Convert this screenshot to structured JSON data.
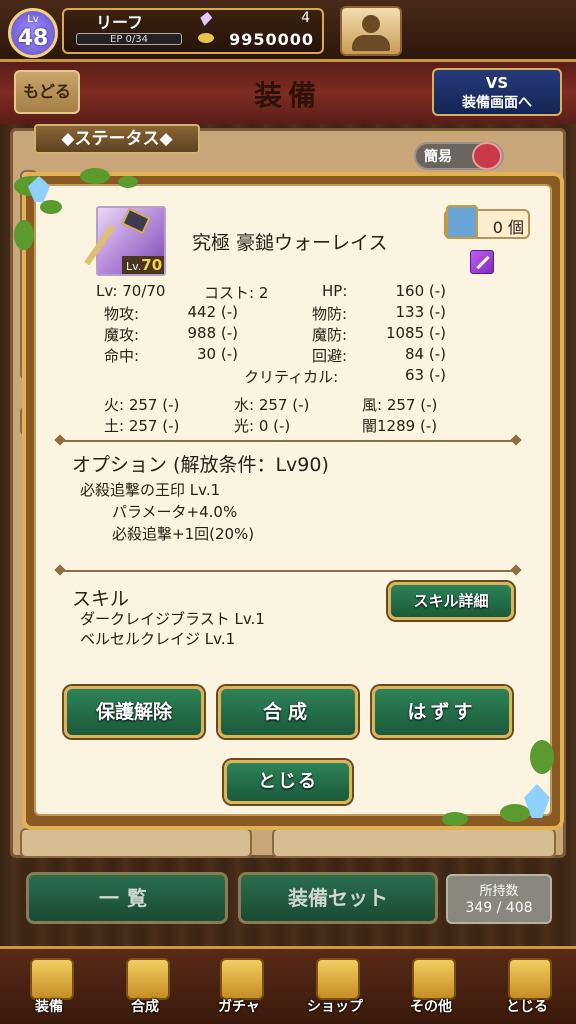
{
  "player": {
    "level_prefix": "Lv",
    "level": "48",
    "name": "リーフ",
    "ep_label": "EP 0/34",
    "crystals": "4",
    "gold": "9950000"
  },
  "header": {
    "back_label": "もどる",
    "title": "装備",
    "vs_line1": "VS",
    "vs_line2": "装備画面へ"
  },
  "status_tab_label": "◆ステータス◆",
  "simple_toggle_label": "簡易",
  "item": {
    "name": "究極 豪鎚ウォーレイス",
    "lv_prefix": "Lv.",
    "lv": "70",
    "owned": "0 個",
    "icons": {
      "weapon_type": "purple-staff-icon",
      "owned": "character-frame-icon"
    }
  },
  "stats": {
    "lv": "Lv:  70/70",
    "cost": "コスト: 2",
    "hp_label": "HP:",
    "hp_value": "160 (-)",
    "patk_label": "物攻:",
    "patk_value": "442 (-)",
    "pdef_label": "物防:",
    "pdef_value": "133 (-)",
    "matk_label": "魔攻:",
    "matk_value": "988 (-)",
    "mdef_label": "魔防:",
    "mdef_value": "1085 (-)",
    "acc_label": "命中:",
    "acc_value": "30 (-)",
    "eva_label": "回避:",
    "eva_value": "84 (-)",
    "crit_label": "クリティカル:",
    "crit_value": "63 (-)",
    "fire": "火: 257 (-)",
    "water": "水: 257 (-)",
    "wind": "風: 257 (-)",
    "earth": "土: 257 (-)",
    "light": "光:    0 (-)",
    "dark": "闇1289 (-)"
  },
  "option": {
    "title": "オプション (解放条件：Lv90)",
    "name": "必殺追撃の王印 Lv.1",
    "effect1": "パラメータ+4.0%",
    "effect2": "必殺追撃+1回(20%)"
  },
  "skill": {
    "title": "スキル",
    "skill1": "ダークレイジブラスト  Lv.1",
    "skill2": "ベルセルクレイジ  Lv.1",
    "detail_button": "スキル詳細"
  },
  "buttons": {
    "protect_release": "保護解除",
    "combine": "合成",
    "remove": "はずす",
    "close": "とじる"
  },
  "bottom_actions": {
    "list": "一覧",
    "equip_set": "装備セット",
    "count_label": "所持数",
    "count_value": "349 / 408"
  },
  "nav": [
    {
      "label": "装備",
      "icon": "equipment-icon"
    },
    {
      "label": "合成",
      "icon": "hammer-icon"
    },
    {
      "label": "ガチャ",
      "icon": "gacha-cards-icon"
    },
    {
      "label": "ショップ",
      "icon": "crystal-shop-icon"
    },
    {
      "label": "その他",
      "icon": "gear-icon"
    },
    {
      "label": "とじる",
      "icon": "close-lion-icon"
    }
  ]
}
